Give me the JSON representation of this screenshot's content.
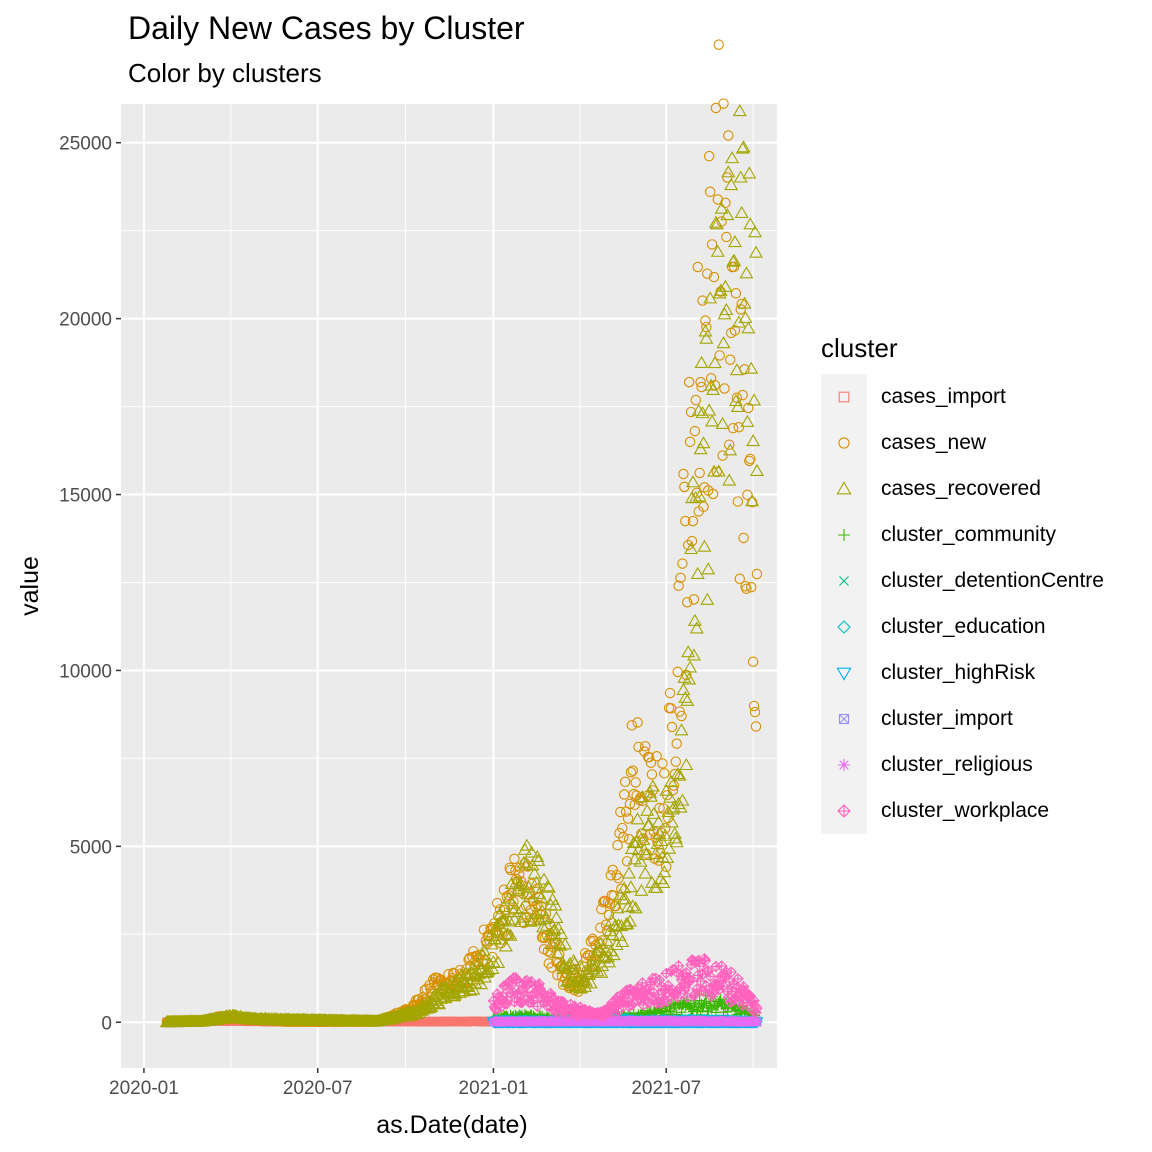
{
  "chart_data": {
    "type": "scatter",
    "title": "Daily New Cases by Cluster",
    "subtitle": "Color by clusters",
    "xlabel": "as.Date(date)",
    "ylabel": "value",
    "x_type": "date",
    "xlim": [
      "2019-12-08",
      "2021-10-25"
    ],
    "ylim": [
      -1300,
      26100
    ],
    "x_ticks": [
      "2020-01",
      "2020-07",
      "2021-01",
      "2021-07"
    ],
    "x_tick_dates": [
      "2020-01-01",
      "2020-07-01",
      "2021-01-01",
      "2021-07-01"
    ],
    "y_ticks": [
      0,
      5000,
      10000,
      15000,
      20000,
      25000
    ],
    "y_tick_labels": [
      "0",
      "5000",
      "10000",
      "15000",
      "20000",
      "25000"
    ],
    "grid": true,
    "legend_title": "cluster",
    "legend_position": "right",
    "series": [
      {
        "name": "cases_import",
        "color": "#F8766D",
        "shape": "square-open",
        "range": [
          "2020-01-25",
          "2021-10-04"
        ],
        "trend": [
          [
            "2020-01-25",
            5
          ],
          [
            "2020-03-20",
            50
          ],
          [
            "2020-06-01",
            10
          ],
          [
            "2020-10-01",
            20
          ],
          [
            "2021-01-01",
            20
          ],
          [
            "2021-06-01",
            15
          ],
          [
            "2021-10-04",
            10
          ]
        ]
      },
      {
        "name": "cases_new",
        "color": "#D89000",
        "shape": "circle-open",
        "range": [
          "2020-01-25",
          "2021-10-04"
        ],
        "trend": [
          [
            "2020-01-25",
            3
          ],
          [
            "2020-03-01",
            20
          ],
          [
            "2020-03-20",
            150
          ],
          [
            "2020-04-15",
            100
          ],
          [
            "2020-06-01",
            20
          ],
          [
            "2020-09-01",
            20
          ],
          [
            "2020-10-01",
            300
          ],
          [
            "2020-11-01",
            1000
          ],
          [
            "2020-12-01",
            1200
          ],
          [
            "2021-01-01",
            2500
          ],
          [
            "2021-01-25",
            4000
          ],
          [
            "2021-02-15",
            3200
          ],
          [
            "2021-03-15",
            1300
          ],
          [
            "2021-04-01",
            1200
          ],
          [
            "2021-05-01",
            3000
          ],
          [
            "2021-05-28",
            7000
          ],
          [
            "2021-06-15",
            6000
          ],
          [
            "2021-07-01",
            6000
          ],
          [
            "2021-07-20",
            13000
          ],
          [
            "2021-08-05",
            18000
          ],
          [
            "2021-08-25",
            22000
          ],
          [
            "2021-09-05",
            20000
          ],
          [
            "2021-09-20",
            16000
          ],
          [
            "2021-10-04",
            11000
          ]
        ]
      },
      {
        "name": "cases_recovered",
        "color": "#A3A500",
        "shape": "triangle-open",
        "range": [
          "2020-01-25",
          "2021-10-04"
        ],
        "trend": [
          [
            "2020-01-25",
            3
          ],
          [
            "2020-03-01",
            20
          ],
          [
            "2020-04-01",
            150
          ],
          [
            "2020-05-01",
            80
          ],
          [
            "2020-06-01",
            60
          ],
          [
            "2020-09-01",
            20
          ],
          [
            "2020-10-15",
            300
          ],
          [
            "2020-11-15",
            900
          ],
          [
            "2020-12-15",
            1300
          ],
          [
            "2021-01-10",
            2500
          ],
          [
            "2021-02-05",
            4000
          ],
          [
            "2021-02-25",
            3500
          ],
          [
            "2021-03-20",
            1500
          ],
          [
            "2021-04-10",
            1200
          ],
          [
            "2021-05-10",
            2500
          ],
          [
            "2021-06-10",
            5500
          ],
          [
            "2021-06-25",
            5000
          ],
          [
            "2021-07-10",
            6000
          ],
          [
            "2021-07-28",
            12000
          ],
          [
            "2021-08-15",
            17000
          ],
          [
            "2021-09-01",
            20000
          ],
          [
            "2021-09-15",
            22000
          ],
          [
            "2021-10-04",
            18000
          ]
        ]
      },
      {
        "name": "cluster_community",
        "color": "#39B600",
        "shape": "plus",
        "range": [
          "2021-01-01",
          "2021-10-04"
        ],
        "trend": [
          [
            "2021-01-01",
            100
          ],
          [
            "2021-02-01",
            200
          ],
          [
            "2021-03-01",
            100
          ],
          [
            "2021-04-15",
            80
          ],
          [
            "2021-06-01",
            200
          ],
          [
            "2021-07-15",
            400
          ],
          [
            "2021-08-15",
            550
          ],
          [
            "2021-09-15",
            350
          ],
          [
            "2021-10-04",
            150
          ]
        ]
      },
      {
        "name": "cluster_detentionCentre",
        "color": "#00BF7D",
        "shape": "cross",
        "range": [
          "2021-01-01",
          "2021-10-04"
        ],
        "trend": [
          [
            "2021-01-01",
            60
          ],
          [
            "2021-03-01",
            40
          ],
          [
            "2021-05-01",
            30
          ],
          [
            "2021-08-01",
            80
          ],
          [
            "2021-10-04",
            40
          ]
        ]
      },
      {
        "name": "cluster_education",
        "color": "#00BFC4",
        "shape": "diamond-open",
        "range": [
          "2021-01-01",
          "2021-10-04"
        ],
        "trend": [
          [
            "2021-01-01",
            40
          ],
          [
            "2021-03-01",
            30
          ],
          [
            "2021-04-25",
            150
          ],
          [
            "2021-06-01",
            40
          ],
          [
            "2021-08-01",
            60
          ],
          [
            "2021-10-04",
            30
          ]
        ]
      },
      {
        "name": "cluster_highRisk",
        "color": "#00B0F6",
        "shape": "triangle-down-open",
        "range": [
          "2021-01-01",
          "2021-10-04"
        ],
        "trend": [
          [
            "2021-01-01",
            10
          ],
          [
            "2021-06-01",
            10
          ],
          [
            "2021-10-04",
            10
          ]
        ]
      },
      {
        "name": "cluster_import",
        "color": "#9590FF",
        "shape": "square-cross",
        "range": [
          "2021-01-01",
          "2021-10-04"
        ],
        "trend": [
          [
            "2021-01-01",
            5
          ],
          [
            "2021-10-04",
            5
          ]
        ]
      },
      {
        "name": "cluster_religious",
        "color": "#E76BF3",
        "shape": "asterisk",
        "range": [
          "2021-01-01",
          "2021-10-04"
        ],
        "trend": [
          [
            "2021-01-01",
            20
          ],
          [
            "2021-04-01",
            30
          ],
          [
            "2021-07-01",
            40
          ],
          [
            "2021-10-04",
            20
          ]
        ]
      },
      {
        "name": "cluster_workplace",
        "color": "#FF62BC",
        "shape": "diamond-plus",
        "range": [
          "2021-01-01",
          "2021-10-04"
        ],
        "trend": [
          [
            "2021-01-01",
            500
          ],
          [
            "2021-01-25",
            1000
          ],
          [
            "2021-02-15",
            800
          ],
          [
            "2021-03-15",
            400
          ],
          [
            "2021-04-20",
            200
          ],
          [
            "2021-05-25",
            700
          ],
          [
            "2021-07-01",
            1000
          ],
          [
            "2021-08-01",
            1300
          ],
          [
            "2021-08-25",
            1200
          ],
          [
            "2021-09-15",
            900
          ],
          [
            "2021-10-04",
            400
          ]
        ]
      }
    ]
  }
}
